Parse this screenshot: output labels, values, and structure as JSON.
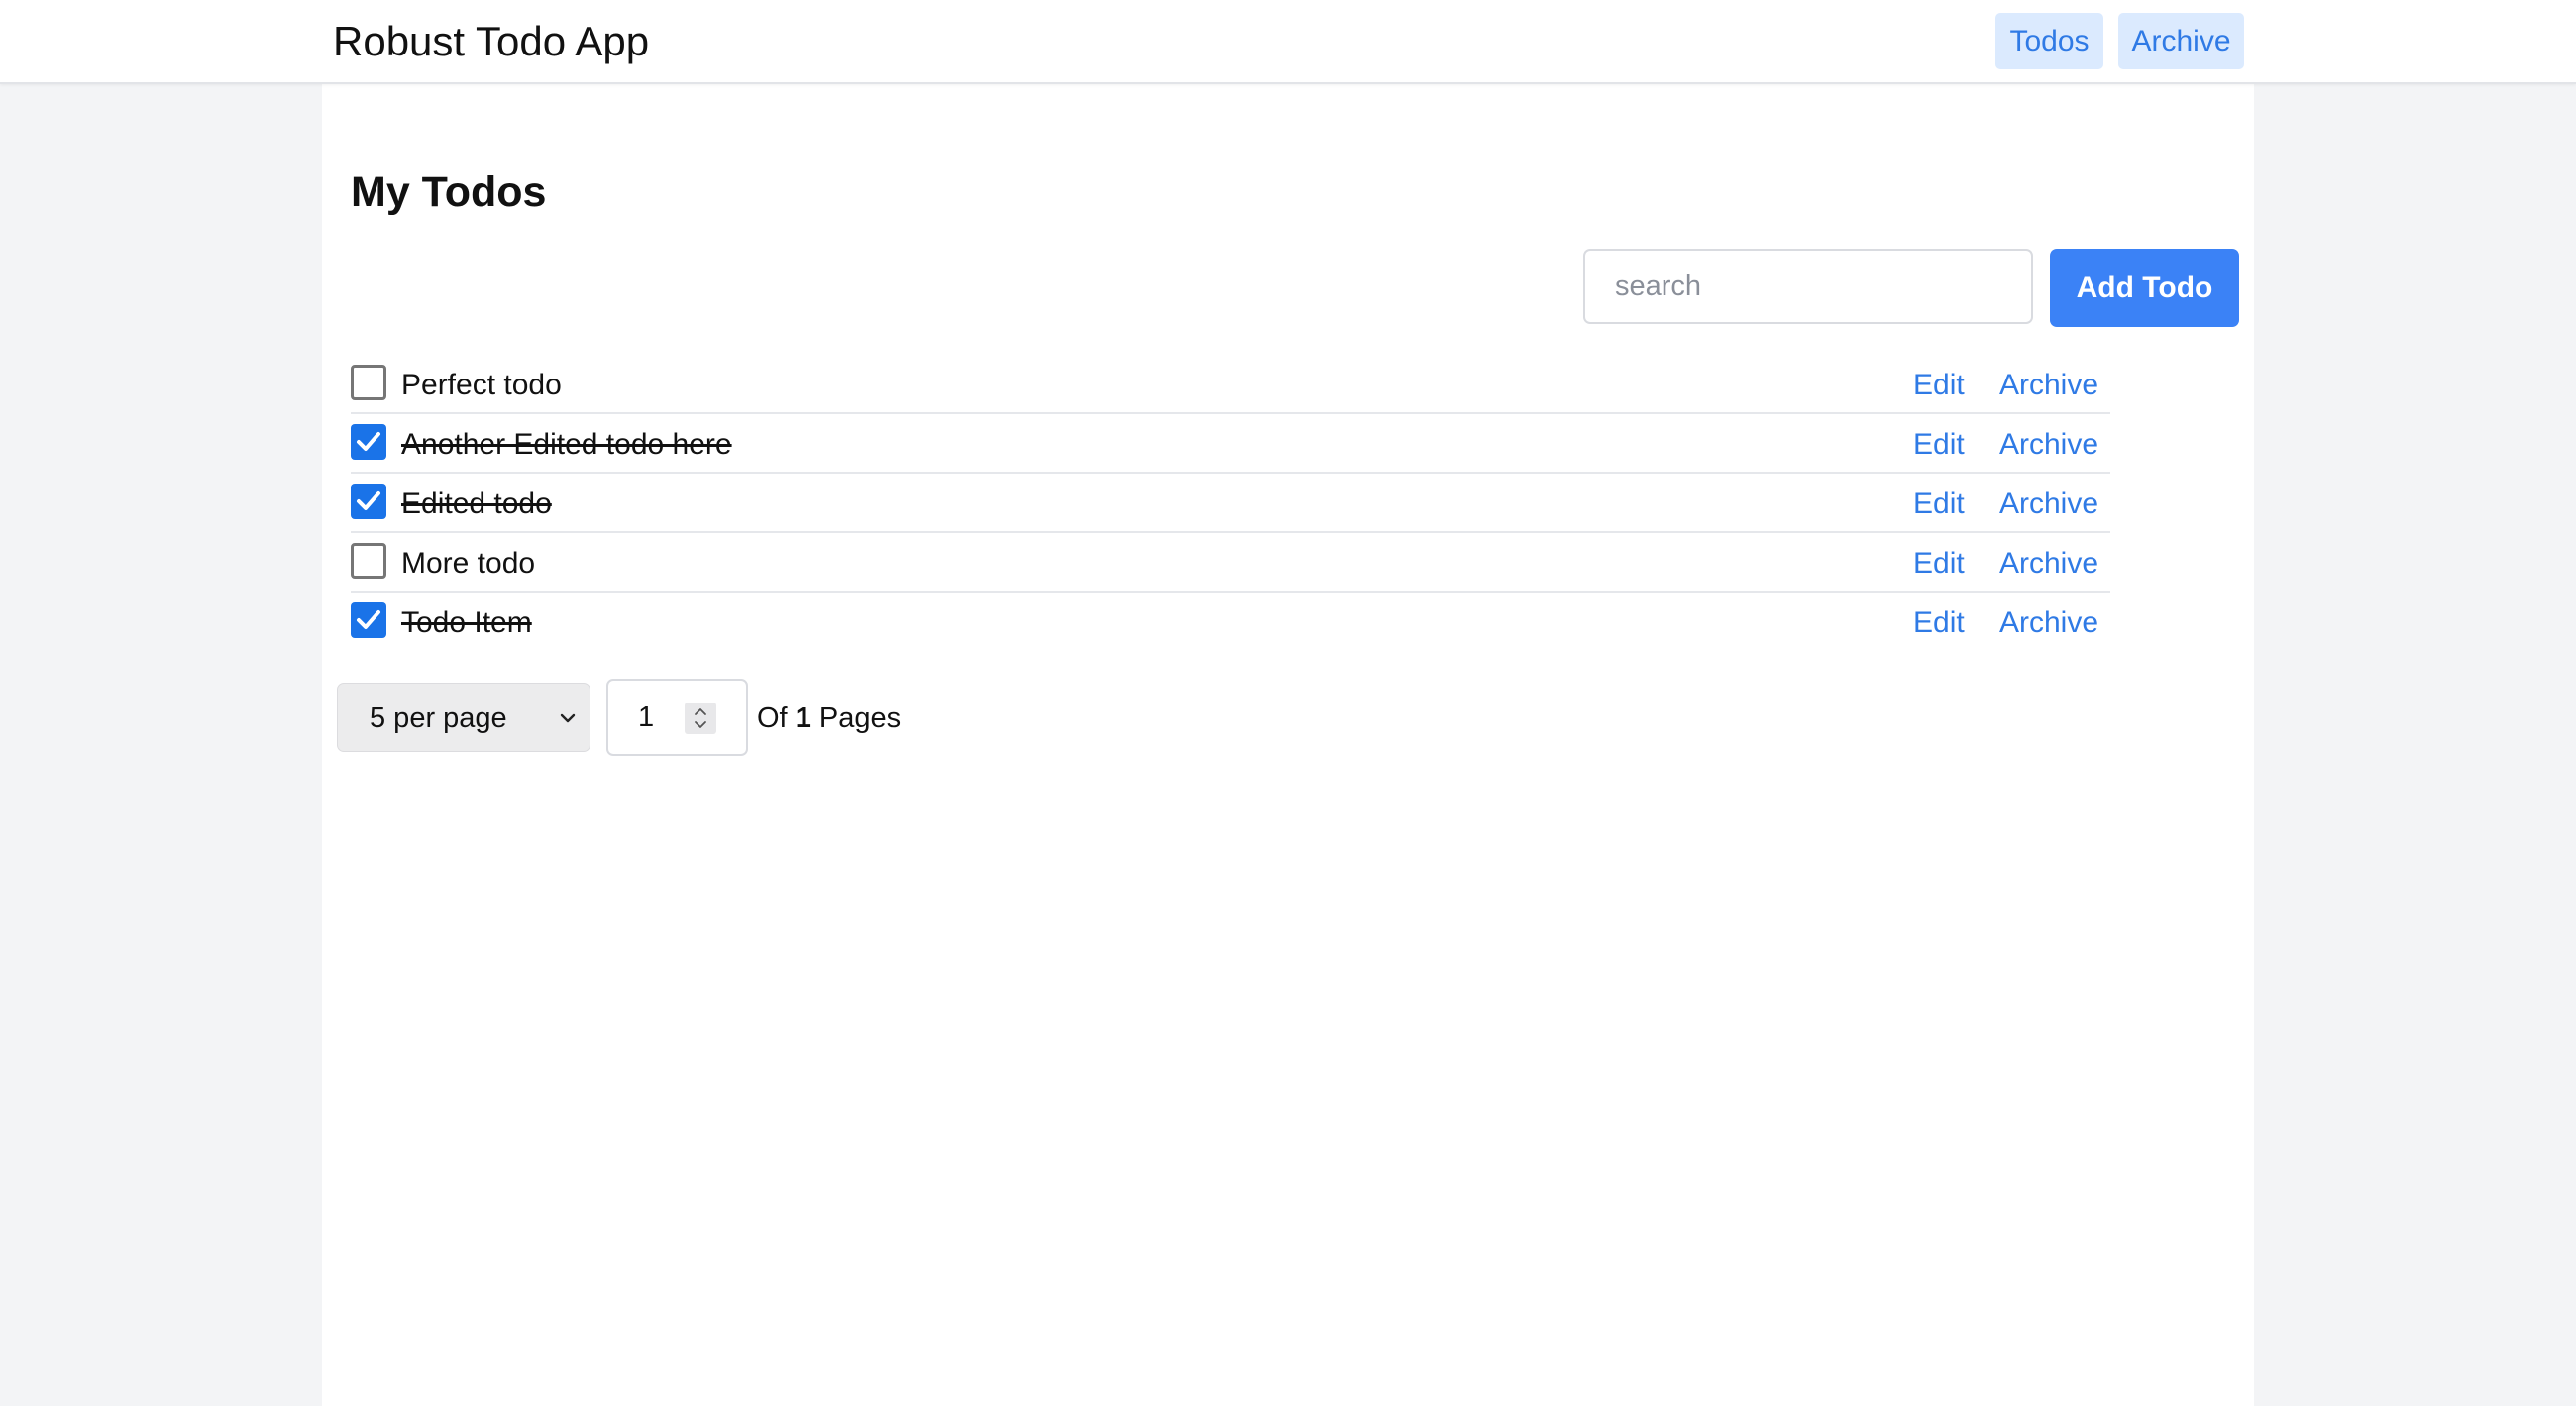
{
  "header": {
    "app_title": "Robust Todo App",
    "nav": [
      {
        "label": "Todos"
      },
      {
        "label": "Archive"
      }
    ]
  },
  "main": {
    "title": "My Todos",
    "search": {
      "placeholder": "search",
      "value": ""
    },
    "add_button_label": "Add Todo",
    "todos": [
      {
        "text": "Perfect todo",
        "done": false,
        "edit_label": "Edit",
        "archive_label": "Archive"
      },
      {
        "text": "Another Edited todo here",
        "done": true,
        "edit_label": "Edit",
        "archive_label": "Archive"
      },
      {
        "text": "Edited todo",
        "done": true,
        "edit_label": "Edit",
        "archive_label": "Archive"
      },
      {
        "text": "More todo",
        "done": false,
        "edit_label": "Edit",
        "archive_label": "Archive"
      },
      {
        "text": "Todo Item",
        "done": true,
        "edit_label": "Edit",
        "archive_label": "Archive"
      }
    ]
  },
  "pagination": {
    "per_page_label": "5 per page",
    "current_page": "1",
    "of_label": "Of",
    "total_pages": "1",
    "pages_label": "Pages"
  },
  "colors": {
    "accent": "#3b82f6",
    "link": "#2f7ae5",
    "checkbox_checked": "#1a73e8",
    "nav_bg": "#dbeafe",
    "page_bg": "#f3f4f6"
  },
  "icons": {
    "checkbox_checked": "checkmark-icon",
    "select": "chevron-down-icon",
    "stepper": "up-down-arrows-icon"
  }
}
